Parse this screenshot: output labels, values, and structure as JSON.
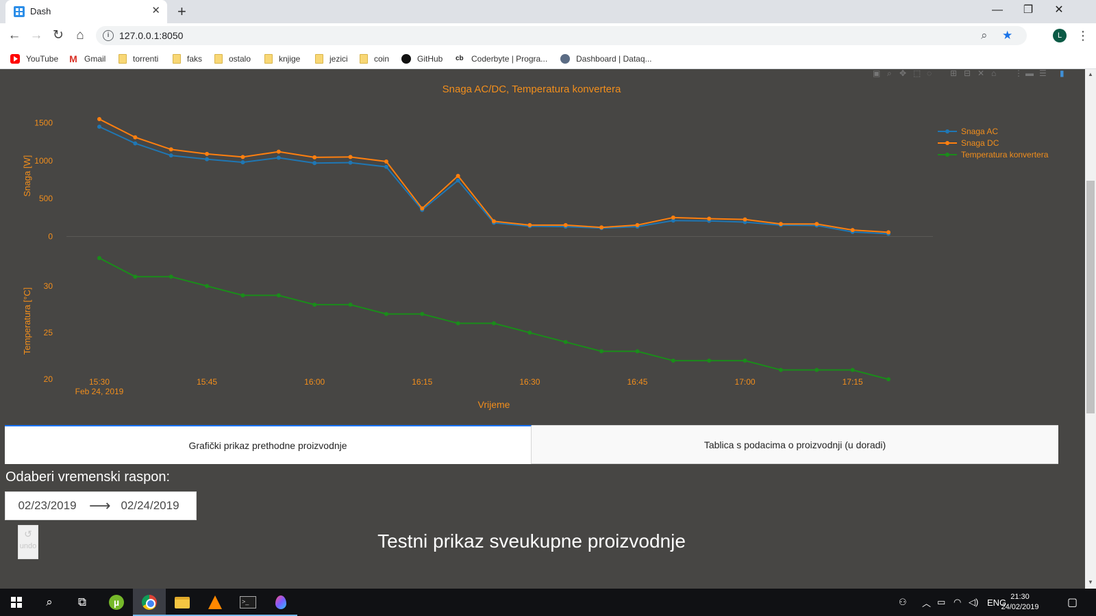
{
  "browser": {
    "tab_title": "Dash",
    "new_tab_glyph": "+",
    "close_glyph": "✕",
    "url": "127.0.0.1:8050",
    "profile_initial": "L",
    "bookmarks": [
      {
        "label": "YouTube",
        "icon": "youtube-icon"
      },
      {
        "label": "Gmail",
        "icon": "gmail-icon"
      },
      {
        "label": "torrenti",
        "icon": "folder-icon"
      },
      {
        "label": "faks",
        "icon": "folder-icon"
      },
      {
        "label": "ostalo",
        "icon": "folder-icon"
      },
      {
        "label": "knjige",
        "icon": "folder-icon"
      },
      {
        "label": "jezici",
        "icon": "folder-icon"
      },
      {
        "label": "coin",
        "icon": "folder-icon"
      },
      {
        "label": "GitHub",
        "icon": "github-icon"
      },
      {
        "label": "Coderbyte | Progra...",
        "icon": "coderbyte-icon"
      },
      {
        "label": "Dashboard | Dataq...",
        "icon": "dataquest-icon"
      }
    ]
  },
  "chart_data": {
    "type": "line",
    "title": "Snaga AC/DC, Temperatura konvertera",
    "xlabel": "Vrijeme",
    "x_ticks": [
      "15:30",
      "15:45",
      "16:00",
      "16:15",
      "16:30",
      "16:45",
      "17:00",
      "17:15"
    ],
    "x_tick_sublabel": "Feb 24, 2019",
    "x": [
      "15:30",
      "15:35",
      "15:40",
      "15:45",
      "15:50",
      "15:55",
      "16:00",
      "16:05",
      "16:10",
      "16:15",
      "16:20",
      "16:25",
      "16:30",
      "16:35",
      "16:40",
      "16:45",
      "16:50",
      "16:55",
      "17:00",
      "17:05",
      "17:10",
      "17:15",
      "17:20"
    ],
    "subplots": [
      {
        "ylabel": "Snaga [W]",
        "y_ticks": [
          0,
          500,
          1000,
          1500
        ],
        "ylim": [
          -50,
          1650
        ],
        "series": [
          "Snaga AC",
          "Snaga DC"
        ]
      },
      {
        "ylabel": "Temperatura [°C]",
        "y_ticks": [
          20,
          25,
          30
        ],
        "ylim": [
          19.5,
          33
        ],
        "series": [
          "Temperatura konvertera"
        ]
      }
    ],
    "series": [
      {
        "name": "Snaga AC",
        "color": "#1f77b4",
        "subplot": 0,
        "values": [
          1450,
          1230,
          1070,
          1020,
          980,
          1040,
          970,
          975,
          920,
          350,
          740,
          180,
          135,
          130,
          110,
          130,
          210,
          205,
          190,
          150,
          145,
          60,
          35
        ]
      },
      {
        "name": "Snaga DC",
        "color": "#ff7f0e",
        "subplot": 0,
        "values": [
          1550,
          1310,
          1150,
          1090,
          1050,
          1120,
          1045,
          1050,
          990,
          370,
          800,
          200,
          150,
          150,
          120,
          150,
          250,
          235,
          225,
          165,
          165,
          85,
          55
        ]
      },
      {
        "name": "Temperatura konvertera",
        "color": "#1a8c1a",
        "subplot": 1,
        "values": [
          33,
          31,
          31,
          30,
          29,
          29,
          28,
          28,
          27,
          27,
          26,
          26,
          25,
          24,
          23,
          23,
          22,
          22,
          22,
          21,
          21,
          21,
          20
        ]
      }
    ],
    "legend_position": "top-right",
    "grid": false
  },
  "tabs": [
    {
      "label": "Grafički prikaz prethodne proizvodnje",
      "selected": true
    },
    {
      "label": "Tablica s podacima o proizvodnji (u doradi)",
      "selected": false
    }
  ],
  "date_picker": {
    "label": "Odaberi vremenski raspon:",
    "start": "02/23/2019",
    "end": "02/24/2019",
    "arrow": "⟶"
  },
  "undo": {
    "icon": "undo-icon",
    "label": "undo"
  },
  "heading": "Testni prikaz sveukupne proizvodnje",
  "taskbar": {
    "language": "ENG",
    "time": "21:30",
    "date": "24/02/2019"
  },
  "colors": {
    "page_bg": "#474644",
    "accent_text": "#f28e1c",
    "tab_active_border": "#1975fa"
  }
}
